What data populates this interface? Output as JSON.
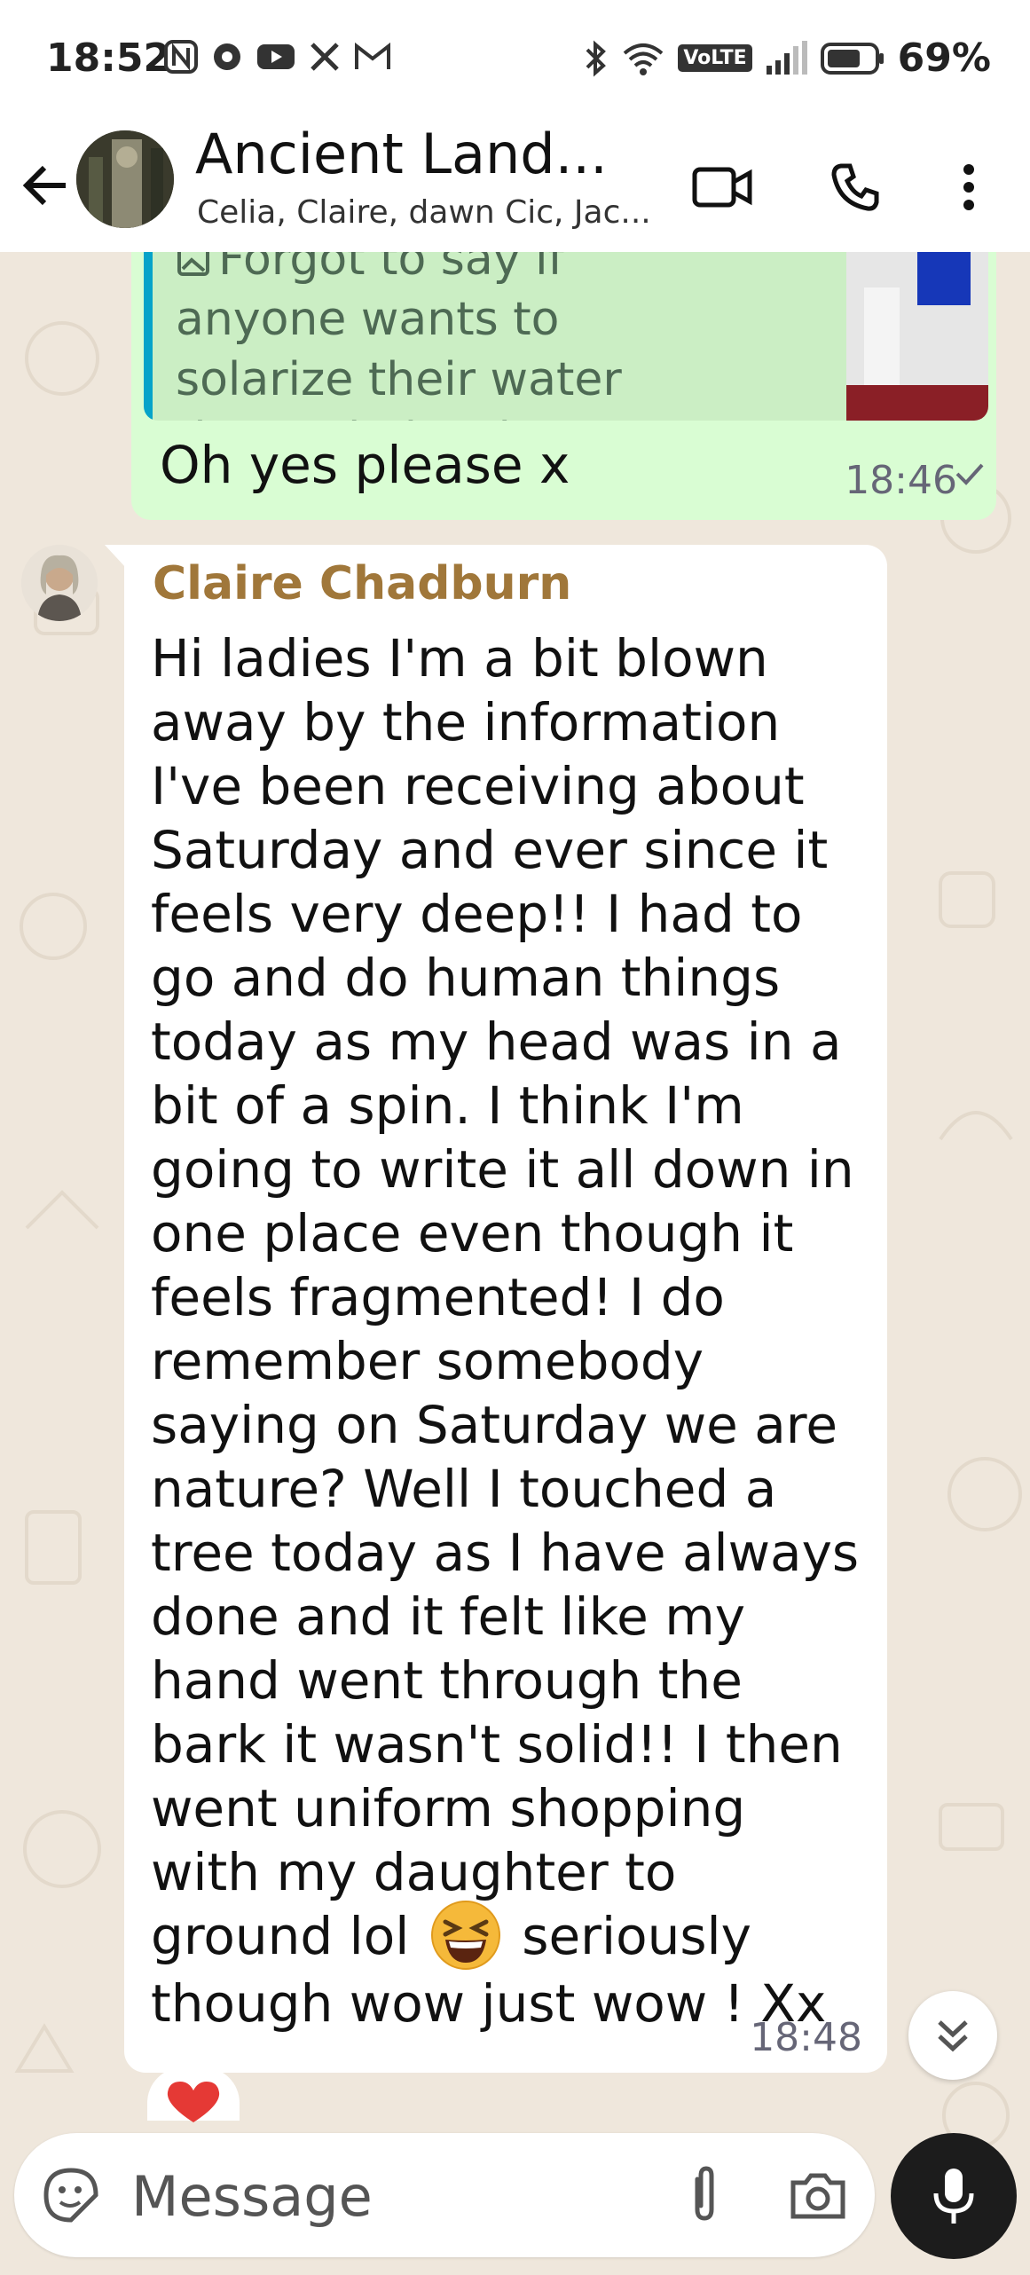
{
  "status_bar": {
    "time": "18:52",
    "battery_percent": "69%",
    "network_badge": "VoLTE",
    "left_icons": [
      "n-icon",
      "settings-flower-icon",
      "youtube-icon",
      "x-icon",
      "gmail-icon"
    ],
    "right_icons": [
      "bluetooth-icon",
      "wifi-icon",
      "volte-icon",
      "signal-icon",
      "battery-icon"
    ]
  },
  "header": {
    "title": "Ancient Land...",
    "subtitle": "Celia, Claire, dawn Cic, Jac...",
    "actions": [
      "video-call-icon",
      "voice-call-icon",
      "more-options-icon"
    ]
  },
  "messages": {
    "outgoing": {
      "quoted_text": "Forgot to say if anyone wants to solarize their water these gin bottles a...",
      "text": "Oh yes please x",
      "time": "18:46",
      "status": "sent"
    },
    "incoming": {
      "sender": "Claire Chadburn",
      "sender_color": "#a0773a",
      "text_part1": "Hi ladies I'm a bit blown away by the information I've been receiving about Saturday and ever since it feels very deep!! I had to go and do human things today as my head was in a bit of a spin. I think  I'm going to write it all down in one place even though it feels fragmented! I do remember somebody saying on Saturday we are nature? Well  I touched a tree today as I have always done and it felt like my hand went through the bark it wasn't solid!! I then went uniform shopping with my daughter to ground lol",
      "emoji": "grinning-squinting-face",
      "text_part2": "seriously though wow just wow ! Xx",
      "time": "18:48",
      "reaction": "red-heart"
    }
  },
  "composer": {
    "placeholder": "Message"
  },
  "colors": {
    "outgoing_bubble": "#d9fdd3",
    "incoming_bubble": "#ffffff",
    "wallpaper": "#efe7dc",
    "quote_bar": "#06a3c9",
    "mic_button": "#1c1c1c"
  }
}
